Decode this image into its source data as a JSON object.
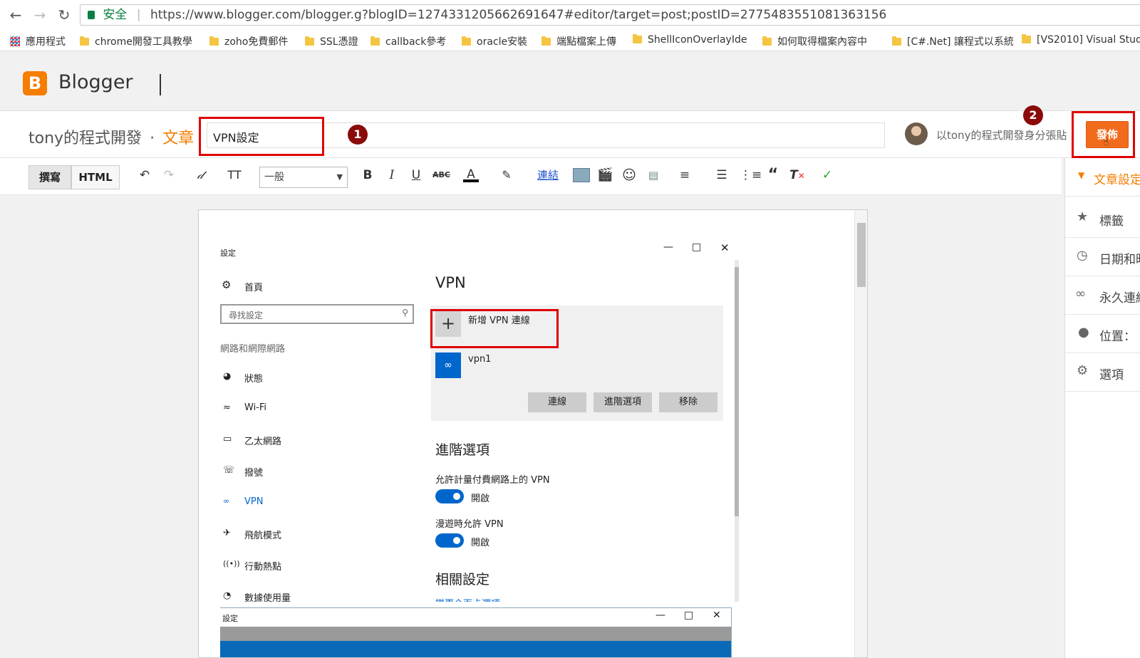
{
  "browser": {
    "secure_label": "安全",
    "url": "https://www.blogger.com/blogger.g?blogID=1274331205662691647#editor/target=post;postID=2775483551081363156"
  },
  "bookmarks": [
    {
      "label": "應用程式"
    },
    {
      "label": "chrome開發工具教學"
    },
    {
      "label": "zoho免費郵件"
    },
    {
      "label": "SSL憑證"
    },
    {
      "label": "callback參考"
    },
    {
      "label": "oracle安裝"
    },
    {
      "label": "端點檔案上傳"
    },
    {
      "label": "ShellIconOverlayIde"
    },
    {
      "label": "如何取得檔案內容中"
    },
    {
      "label": "[C#.Net] 讓程式以系統"
    },
    {
      "label": "[VS2010] Visual Stud"
    }
  ],
  "header": {
    "brand": "Blogger"
  },
  "post": {
    "blog_name": "tony的程式開發",
    "separator": "·",
    "post_label": "文章",
    "title_value": "VPN設定",
    "publish_as": "以tony的程式開發身分張貼",
    "publish_label": "發佈"
  },
  "annotations": {
    "badge1": "1",
    "badge2": "2"
  },
  "editor": {
    "tab_compose": "撰寫",
    "tab_html": "HTML",
    "font_size": "一般",
    "link_label": "連結"
  },
  "sidebar": {
    "settings_header": "文章設定",
    "items": [
      {
        "label": "標籤"
      },
      {
        "label": "日期和時"
      },
      {
        "label": "永久連結"
      },
      {
        "label": "位置："
      },
      {
        "label": "選項"
      }
    ]
  },
  "settings": {
    "title": "設定",
    "home": "首頁",
    "search_placeholder": "尋找設定",
    "section": "網路和網際網路",
    "nav": [
      {
        "label": "狀態"
      },
      {
        "label": "Wi-Fi"
      },
      {
        "label": "乙太網路"
      },
      {
        "label": "撥號"
      },
      {
        "label": "VPN"
      },
      {
        "label": "飛航模式"
      },
      {
        "label": "行動熱點"
      },
      {
        "label": "數據使用量"
      }
    ],
    "vpn_heading": "VPN",
    "add_vpn": "新增 VPN 連線",
    "vpn_name": "vpn1",
    "connect": "連線",
    "advanced_btn": "進階選項",
    "remove": "移除",
    "advanced_heading": "進階選項",
    "metered_label": "允許計量付費網路上的 VPN",
    "metered_state": "開啟",
    "roaming_label": "漫遊時允許 VPN",
    "roaming_state": "開啟",
    "related_heading": "相關設定",
    "related_link": "變更介面卡選項"
  },
  "settings2": {
    "title": "設定"
  }
}
